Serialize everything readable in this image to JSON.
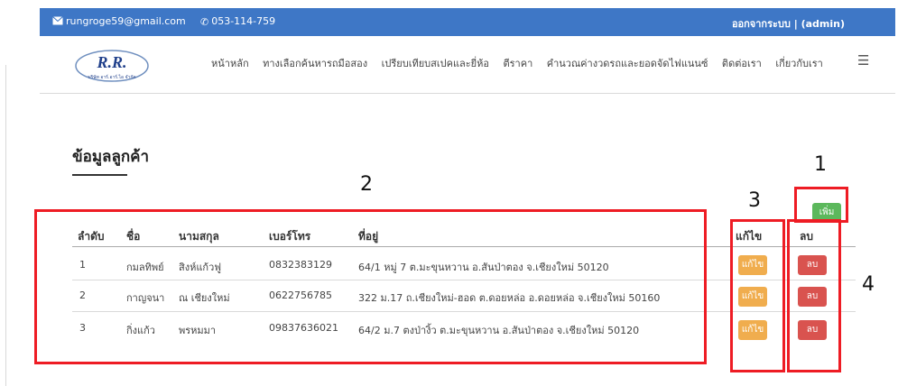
{
  "topbar": {
    "email": "rungroge59@gmail.com",
    "phone": "053-114-759",
    "logout": "ออกจากระบบ",
    "user": "admin",
    "color": "#3e77c6"
  },
  "logo": {
    "text": "R.R.",
    "subtitle": "บริษัท อาร์.อาร์.ไอ จำกัด"
  },
  "nav": {
    "items": [
      "หน้าหลัก",
      "ทางเลือกค้นหารถมือสอง",
      "เปรียบเทียบสเปคและยี่ห้อ",
      "ตีราคา",
      "คำนวณค่างวดรถและยอดจัดไฟแนนซ์",
      "ติดต่อเรา",
      "เกี่ยวกับเรา"
    ]
  },
  "page_title": "ข้อมูลลูกค้า",
  "table": {
    "headers": [
      "ลำดับ",
      "ชื่อ",
      "นามสกุล",
      "เบอร์โทร",
      "ที่อยู่",
      "แก้ไข",
      "ลบ"
    ],
    "rows": [
      [
        "1",
        "กมลทิพย์",
        "สิงห์แก้วฟู",
        "0832383129",
        "64/1 หมู่ 7 ต.มะขุนหวาน อ.สันป่าตอง จ.เชียงใหม่ 50120"
      ],
      [
        "2",
        "กาญจนา",
        "ณ เชียงใหม่",
        "0622756785",
        "322 ม.17 ถ.เชียงใหม่-ฮอด ต.ดอยหล่อ อ.ดอยหล่อ จ.เชียงใหม่ 50160"
      ],
      [
        "3",
        "กิ่งแก้ว",
        "พรหมมา",
        "09837636021",
        "64/2 ม.7 ตงป่างิ้ว ต.มะขุนหวาน อ.สันป่าตอง จ.เชียงใหม่ 50120"
      ]
    ]
  },
  "buttons": {
    "add": "เพิ่ม",
    "edit": "แก้ไข",
    "delete": "ลบ"
  },
  "annotations": [
    "1",
    "2",
    "3",
    "4"
  ]
}
